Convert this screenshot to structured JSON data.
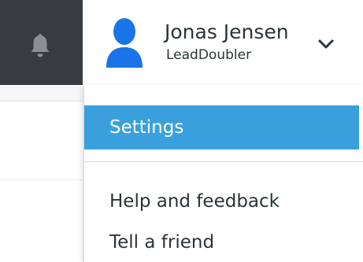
{
  "header": {
    "notifications_icon": "bell-icon",
    "user": {
      "avatar_icon": "user-avatar-icon",
      "name": "Jonas Jensen",
      "organization": "LeadDoubler",
      "menu_toggle_icon": "chevron-down-icon"
    }
  },
  "user_menu": {
    "items": [
      {
        "label": "Settings",
        "active": true
      },
      {
        "label": "Help and feedback",
        "active": false
      },
      {
        "label": "Tell a friend",
        "active": false
      }
    ]
  },
  "colors": {
    "header_dark": "#363c41",
    "accent": "#3aa0dd",
    "text": "#2a3338",
    "avatar_blue": "#1a73e8",
    "bell_gray": "#8a9096"
  }
}
